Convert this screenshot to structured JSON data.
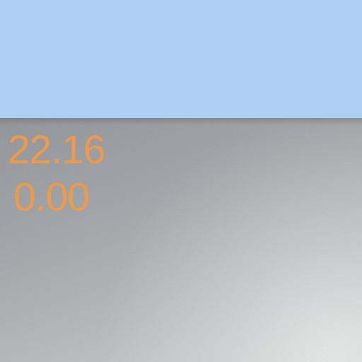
{
  "background": {
    "sky_color": "#aed0f4",
    "panel_color": "#a4a8ab"
  },
  "readout": {
    "line_1_separator": ":",
    "line_1_value": "22.16",
    "line_2_value": "0.00",
    "text_color": "#ec9a4e"
  }
}
